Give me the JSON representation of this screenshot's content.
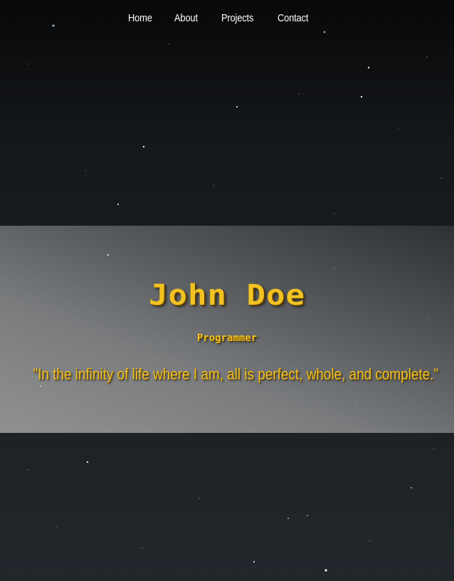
{
  "nav": {
    "home": "Home",
    "about": "About",
    "projects": "Projects",
    "contact": "Contact"
  },
  "hero": {
    "name": "John Doe",
    "role": "Programmer",
    "quote": "\"In the infinity of life where I am, all is perfect, whole, and complete.\""
  },
  "colors": {
    "accent": "#f2c222",
    "background": "#1c1f23",
    "hero_band": "#7a7c7e",
    "nav_text": "#ffffff"
  }
}
